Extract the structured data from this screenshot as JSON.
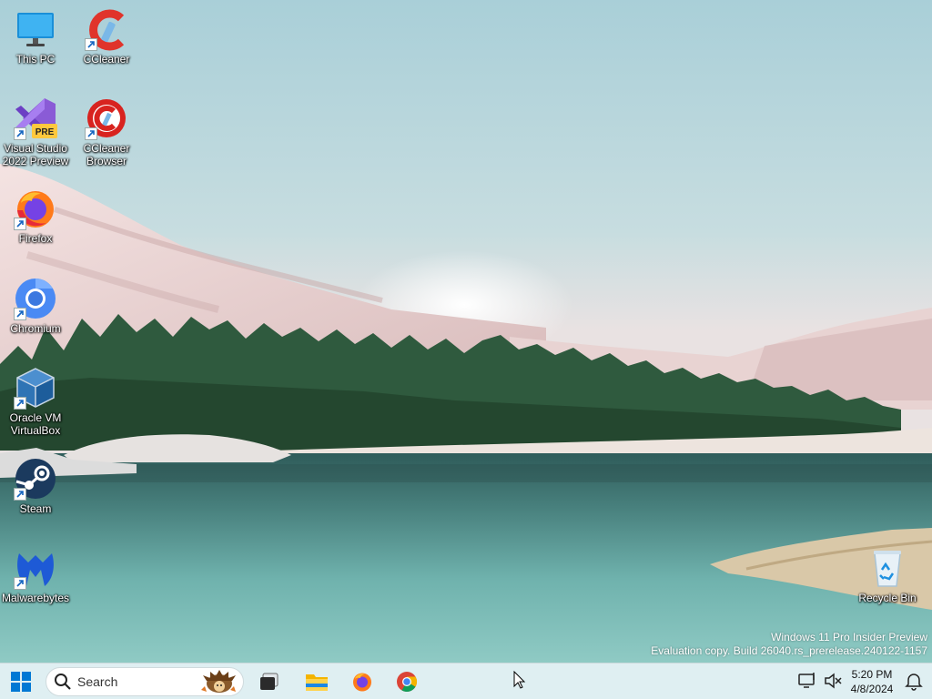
{
  "desktop_icons": [
    {
      "label": "This PC",
      "icon": "computer-monitor-icon"
    },
    {
      "label": "CCleaner",
      "icon": "ccleaner-icon"
    },
    {
      "label": "Visual Studio\n2022 Preview",
      "icon": "visual-studio-preview-icon",
      "badge": "PRE"
    },
    {
      "label": "CCleaner\nBrowser",
      "icon": "ccleaner-browser-icon"
    },
    {
      "label": "Firefox",
      "icon": "firefox-icon"
    },
    {
      "label": "Chromium",
      "icon": "chromium-icon"
    },
    {
      "label": "Oracle VM\nVirtualBox",
      "icon": "virtualbox-icon"
    },
    {
      "label": "Steam",
      "icon": "steam-icon"
    },
    {
      "label": "Malwarebytes",
      "icon": "malwarebytes-icon"
    },
    {
      "label": "Recycle Bin",
      "icon": "recycle-bin-icon"
    }
  ],
  "watermark": {
    "line1": "Windows 11 Pro Insider Preview",
    "line2": "Evaluation copy. Build 26040.rs_prerelease.240122-1157"
  },
  "taskbar": {
    "search_placeholder": "Search",
    "pinned": [
      "task-view-icon",
      "file-explorer-icon",
      "firefox-icon",
      "chrome-icon"
    ],
    "clock": {
      "time": "5:20 PM",
      "date": "4/8/2024"
    }
  },
  "colors": {
    "taskbar_bg": "#dfeff2",
    "accent": "#0067c0"
  }
}
